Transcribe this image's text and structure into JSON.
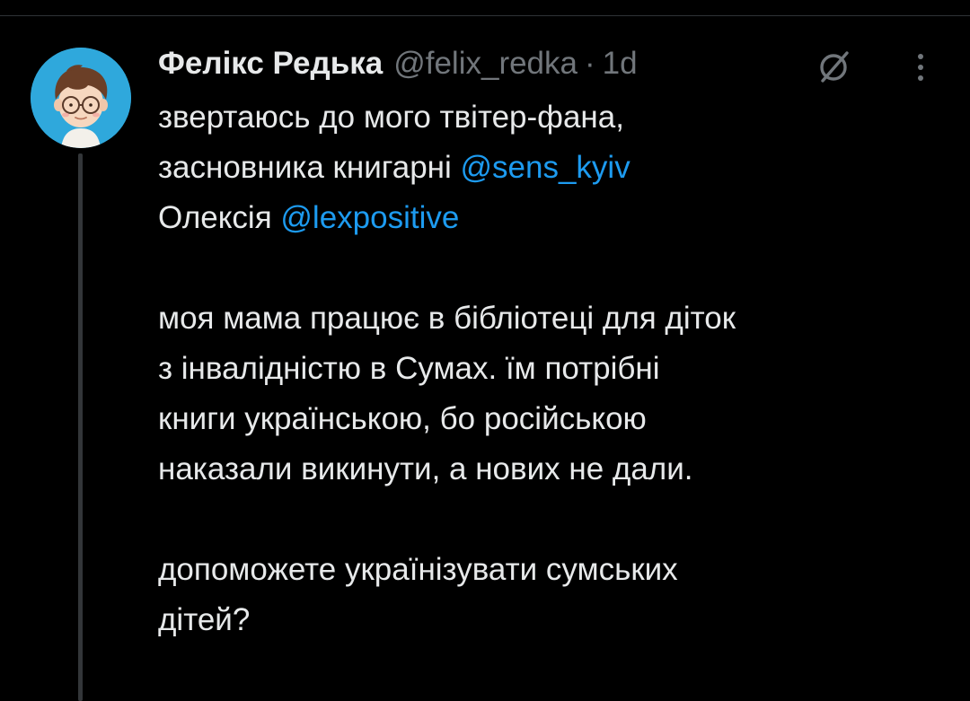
{
  "tweet": {
    "author": {
      "display_name": "Фелікс Редька",
      "handle": "@felix_redka",
      "avatar_icon": "cartoon-avatar-icon"
    },
    "separator": "·",
    "time": "1d",
    "paragraphs": [
      {
        "lines": [
          [
            {
              "text": "звертаюсь до мого твітер-фана,",
              "type": "text"
            }
          ],
          [
            {
              "text": "засновника книгарні ",
              "type": "text"
            },
            {
              "text": "@sens_kyiv",
              "type": "mention"
            }
          ],
          [
            {
              "text": "Олексія ",
              "type": "text"
            },
            {
              "text": "@lexpositive",
              "type": "mention"
            }
          ]
        ]
      },
      {
        "lines": [
          [
            {
              "text": "моя мама працює в бібліотеці для діток",
              "type": "text"
            }
          ],
          [
            {
              "text": "з інвалідністю в Сумах. їм потрібні",
              "type": "text"
            }
          ],
          [
            {
              "text": "книги українською, бо російською",
              "type": "text"
            }
          ],
          [
            {
              "text": "наказали викинути, а нових не дали.",
              "type": "text"
            }
          ]
        ]
      },
      {
        "lines": [
          [
            {
              "text": "допоможете українізувати сумських",
              "type": "text"
            }
          ],
          [
            {
              "text": "дітей?",
              "type": "text"
            }
          ]
        ]
      }
    ],
    "icons": {
      "grok": "grok-icon",
      "more": "more-options-icon"
    }
  },
  "colors": {
    "background": "#000000",
    "text_primary": "#e7e9ea",
    "text_secondary": "#71767b",
    "mention": "#1d9bf0",
    "avatar_bg": "#2fa8dc",
    "thread_line": "#333639"
  }
}
